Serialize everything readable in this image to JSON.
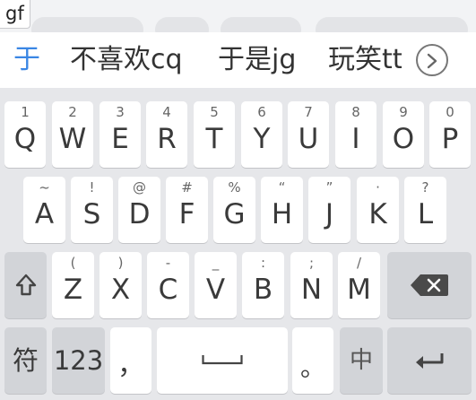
{
  "composing_text": "gf",
  "candidates": [
    "于",
    "不喜欢cq",
    "于是jg",
    "玩笑tt"
  ],
  "keyboard": {
    "row1": [
      {
        "num": "1",
        "letter": "Q"
      },
      {
        "num": "2",
        "letter": "W"
      },
      {
        "num": "3",
        "letter": "E"
      },
      {
        "num": "4",
        "letter": "R"
      },
      {
        "num": "5",
        "letter": "T"
      },
      {
        "num": "6",
        "letter": "Y"
      },
      {
        "num": "7",
        "letter": "U"
      },
      {
        "num": "8",
        "letter": "I"
      },
      {
        "num": "9",
        "letter": "O"
      },
      {
        "num": "0",
        "letter": "P"
      }
    ],
    "row2": [
      {
        "sym": "~",
        "letter": "A"
      },
      {
        "sym": "!",
        "letter": "S"
      },
      {
        "sym": "@",
        "letter": "D"
      },
      {
        "sym": "#",
        "letter": "F"
      },
      {
        "sym": "%",
        "letter": "G"
      },
      {
        "sym": "“",
        "letter": "H"
      },
      {
        "sym": "”",
        "letter": "J"
      },
      {
        "sym": "·",
        "letter": "K"
      },
      {
        "sym": "?",
        "letter": "L"
      }
    ],
    "row3": [
      {
        "sym": "(",
        "letter": "Z"
      },
      {
        "sym": ")",
        "letter": "X"
      },
      {
        "sym": "-",
        "letter": "C"
      },
      {
        "sym": "_",
        "letter": "V"
      },
      {
        "sym": ":",
        "letter": "B"
      },
      {
        "sym": ";",
        "letter": "N"
      },
      {
        "sym": "/",
        "letter": "M"
      }
    ],
    "symbols_label": "符",
    "numbers_label": "123",
    "comma_label": "，",
    "period_label": "。",
    "lang_label": "中",
    "icons": {
      "shift": "shift-icon",
      "backspace": "backspace-icon",
      "space": "space-bar-icon",
      "enter": "enter-icon",
      "more": "chevron-right-icon"
    },
    "colors": {
      "candidate_highlight": "#3a86e4",
      "function_key": "#d2d4d8",
      "key": "#ffffff",
      "background": "#e6e7ea"
    }
  }
}
